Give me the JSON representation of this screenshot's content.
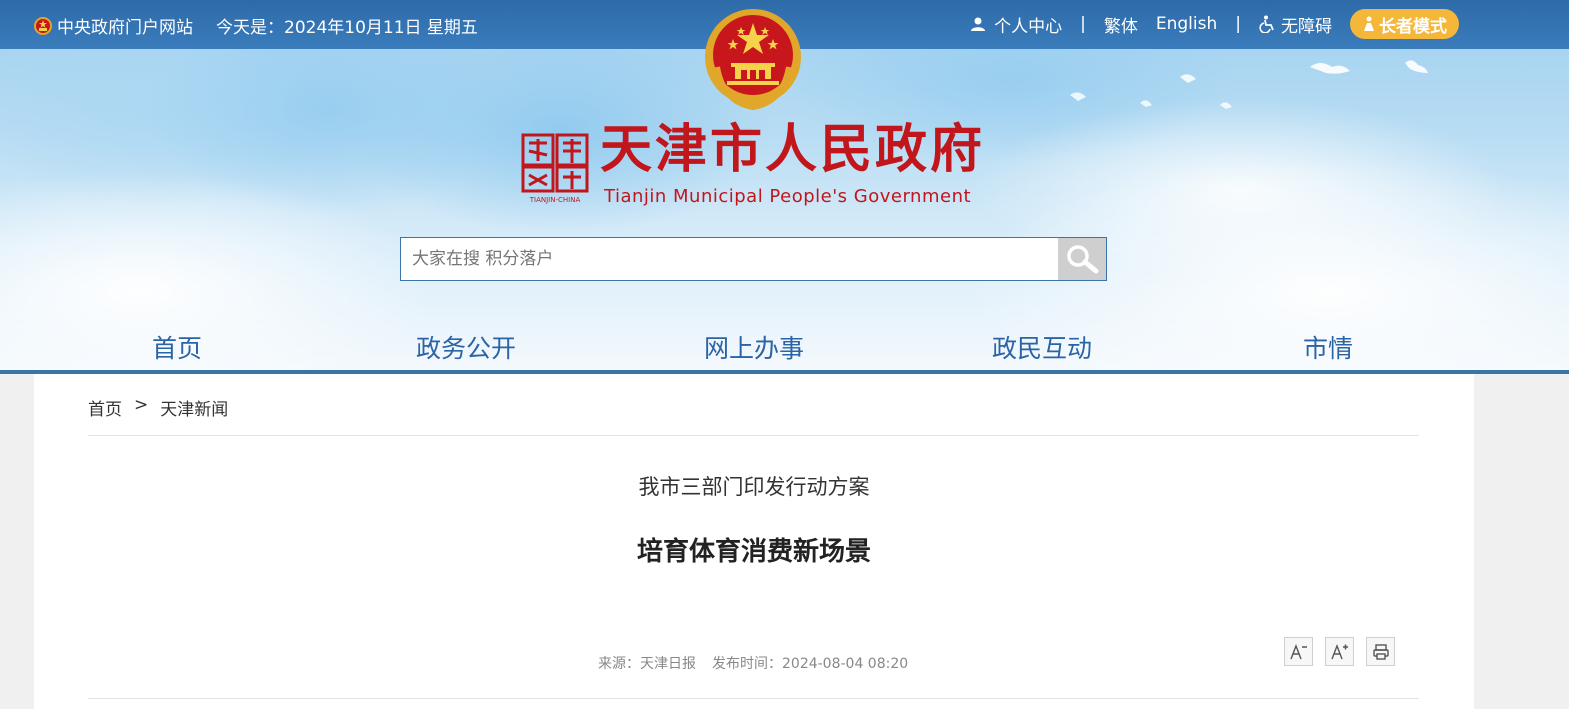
{
  "topbar": {
    "gov_portal": "中央政府门户网站",
    "date_text": "今天是：2024年10月11日 星期五",
    "personal_center": "个人中心",
    "separator": "|",
    "traditional": "繁体",
    "english": "English",
    "accessibility": "无障碍",
    "elder_mode": "长者模式"
  },
  "header": {
    "title": "天津市人民政府",
    "subtitle": "Tianjin Municipal People's Government",
    "seal_text": "TIANJIN-CHINA"
  },
  "search": {
    "placeholder": "大家在搜 积分落户"
  },
  "nav": {
    "items": [
      "首页",
      "政务公开",
      "网上办事",
      "政民互动",
      "市情"
    ]
  },
  "breadcrumb": {
    "home": "首页",
    "arrow": ">",
    "current": "天津新闻"
  },
  "article": {
    "pretitle": "我市三部门印发行动方案",
    "title": "培育体育消费新场景",
    "source": "来源：天津日报",
    "publish_time": "发布时间：2024-08-04 08:20"
  },
  "colors": {
    "topbar": "#2e6aa8",
    "title_red": "#c0161c",
    "nav_blue": "#2a64a6",
    "elder_yellow": "#f4b73a"
  }
}
